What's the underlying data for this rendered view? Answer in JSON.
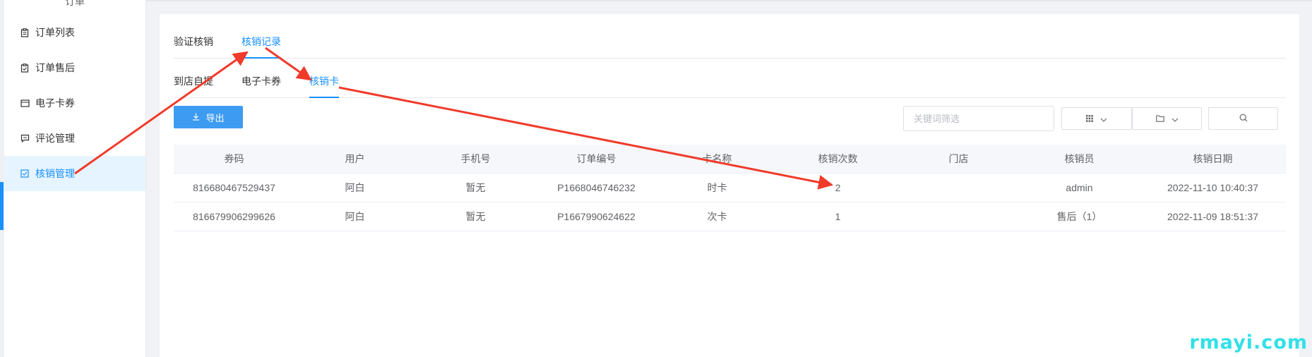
{
  "sidebar": {
    "title": "订单",
    "items": [
      {
        "label": "订单列表",
        "icon": "clipboard-icon"
      },
      {
        "label": "订单售后",
        "icon": "clipboard-check-icon"
      },
      {
        "label": "电子卡券",
        "icon": "card-icon"
      },
      {
        "label": "评论管理",
        "icon": "comment-icon"
      },
      {
        "label": "核销管理",
        "icon": "checkbox-icon",
        "active": true
      }
    ]
  },
  "tabs_main": [
    {
      "label": "验证核销"
    },
    {
      "label": "核销记录",
      "active": true
    }
  ],
  "tabs_sub": [
    {
      "label": "到店自提"
    },
    {
      "label": "电子卡券"
    },
    {
      "label": "核销卡",
      "active": true
    }
  ],
  "toolbar": {
    "export_label": "导出",
    "search_placeholder": "关键词筛选"
  },
  "table": {
    "columns": [
      "券码",
      "用户",
      "手机号",
      "订单编号",
      "卡名称",
      "核销次数",
      "门店",
      "核销员",
      "核销日期"
    ],
    "rows": [
      [
        "816680467529437",
        "阿白",
        "暂无",
        "P1668046746232",
        "时卡",
        "2",
        "",
        "admin",
        "2022-11-10 10:40:37"
      ],
      [
        "816679906299626",
        "阿白",
        "暂无",
        "P1667990624622",
        "次卡",
        "1",
        "",
        "售后（1）",
        "2022-11-09 18:51:37"
      ]
    ]
  },
  "watermark": "rmayi.com",
  "colors": {
    "accent": "#1890ff",
    "annotation_arrow": "#f03a2a",
    "watermark": "#33e0e8"
  }
}
